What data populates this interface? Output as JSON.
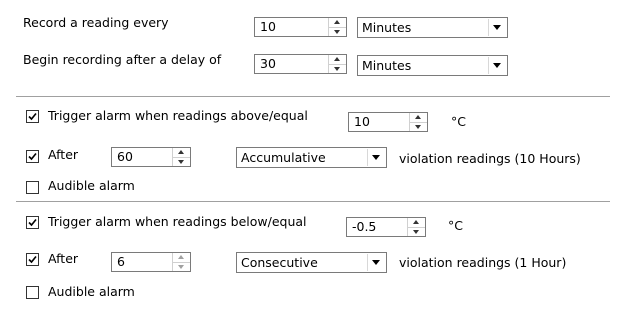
{
  "record": {
    "label": "Record a reading every",
    "interval_value": "10",
    "interval_unit": "Minutes"
  },
  "delay": {
    "label": "Begin recording after a delay of",
    "value": "30",
    "unit": "Minutes"
  },
  "high_alarm": {
    "checked": true,
    "label": "Trigger alarm when readings above/equal",
    "threshold": "10",
    "unit": "°C",
    "after_checked": true,
    "after_label": "After",
    "after_value": "60",
    "mode": "Accumulative",
    "violation_text": "violation readings (10 Hours)",
    "audible_checked": false,
    "audible_label": "Audible alarm"
  },
  "low_alarm": {
    "checked": true,
    "label": "Trigger alarm when readings below/equal",
    "threshold": "-0.5",
    "unit": "°C",
    "after_checked": true,
    "after_label": "After",
    "after_value": "6",
    "mode": "Consecutive",
    "violation_text": "violation readings (1 Hour)",
    "audible_checked": false,
    "audible_label": "Audible alarm"
  }
}
